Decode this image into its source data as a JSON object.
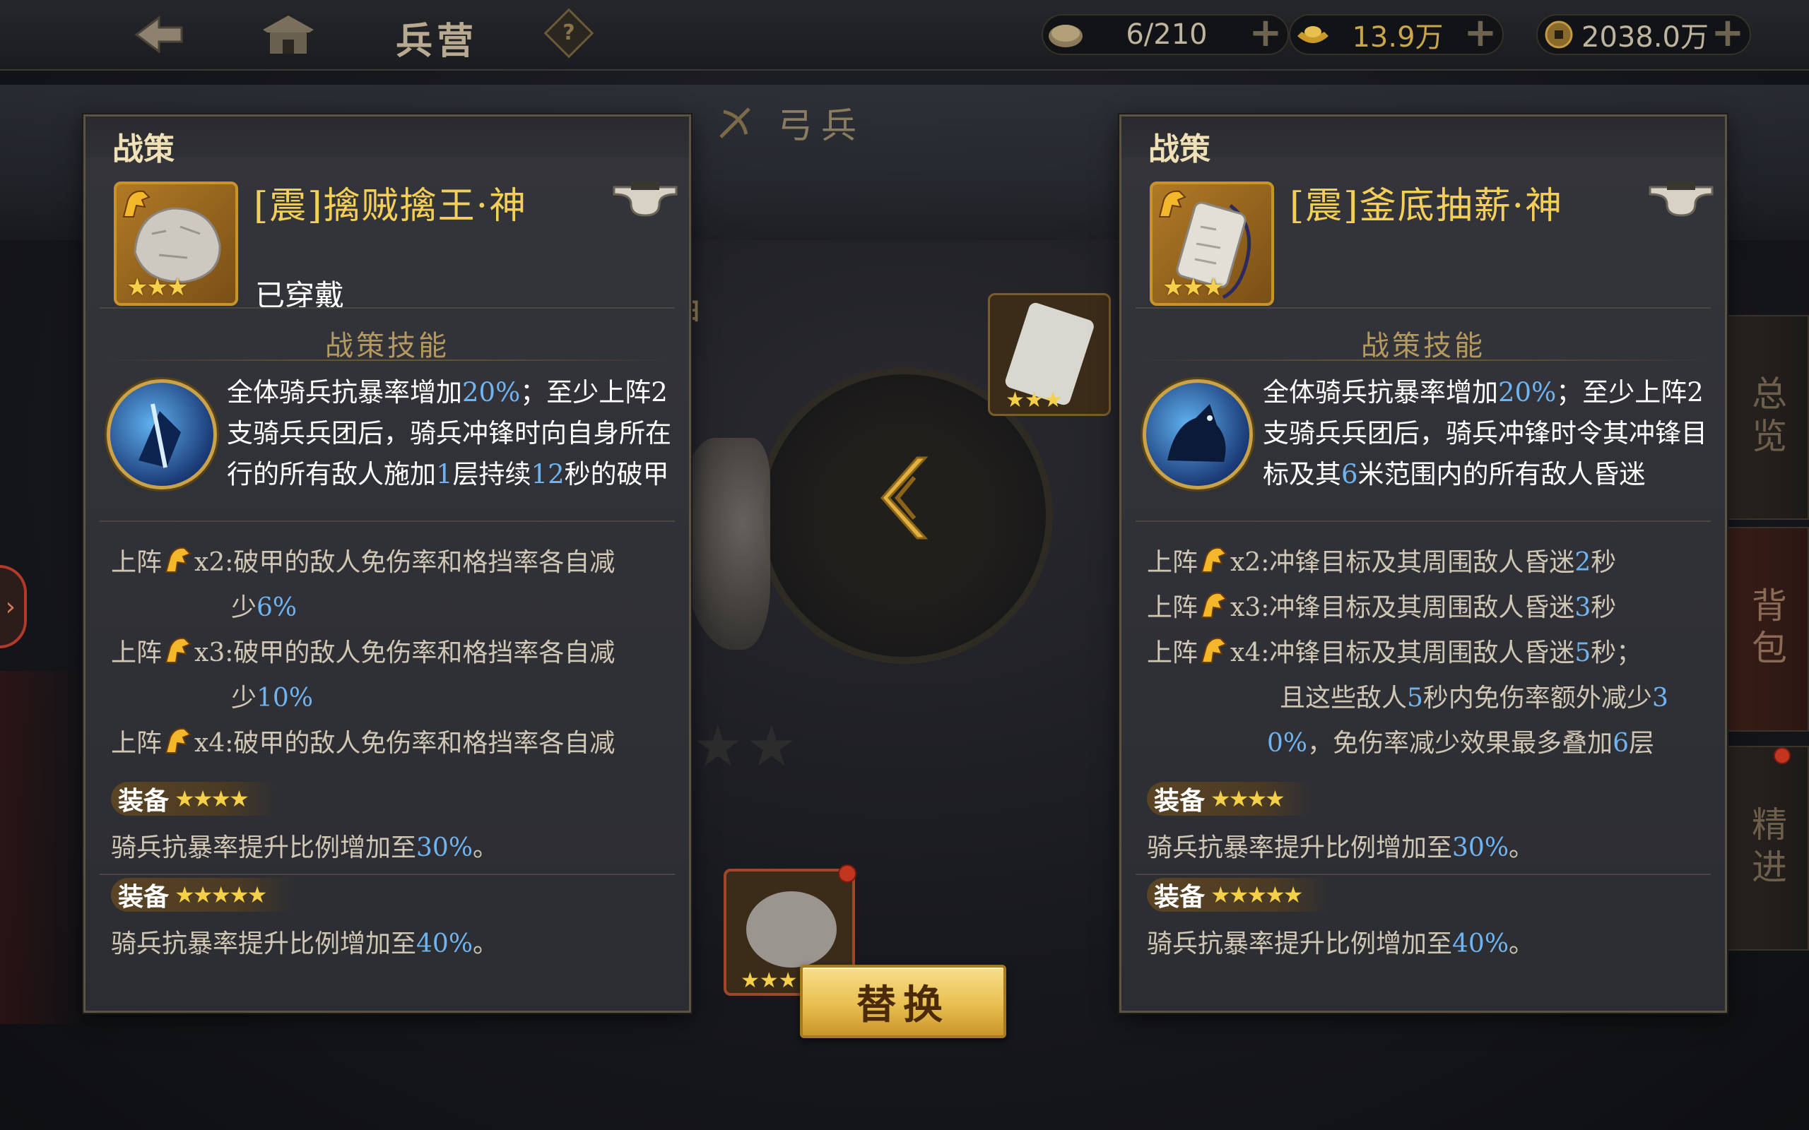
{
  "topbar": {
    "title": "兵营",
    "help": "?",
    "resources": [
      {
        "icon": "food-icon",
        "value": "6/210"
      },
      {
        "icon": "gold-ingot-icon",
        "value": "13.9万"
      },
      {
        "icon": "coin-icon",
        "value": "2038.0万"
      }
    ]
  },
  "tabs": {
    "archer": "弓兵"
  },
  "center": {
    "title_fragment": "· 神"
  },
  "right_nav": [
    "总览",
    "背包",
    "精进"
  ],
  "replace_button": "替换",
  "left_panel": {
    "label": "战策",
    "name": "[震]擒贼擒王·神",
    "status": "已穿戴",
    "stars": 3,
    "section_title": "战策技能",
    "skill_parts": [
      {
        "t": "全体骑兵抗暴率增加",
        "h": false
      },
      {
        "t": "20%",
        "h": true
      },
      {
        "t": "；至少上阵2支骑兵兵团后，骑兵冲锋时向自身所在行的所有敌人施加",
        "h": false
      },
      {
        "t": "1",
        "h": true
      },
      {
        "t": "层持续",
        "h": false
      },
      {
        "t": "12",
        "h": true
      },
      {
        "t": "秒的破甲",
        "h": false
      }
    ],
    "tiers": [
      {
        "prefix": "上阵",
        "count": "x2:",
        "text": "破甲的敌人免伤率和格挡率各自减",
        "cont": "少",
        "val": "6%"
      },
      {
        "prefix": "上阵",
        "count": "x3:",
        "text": "破甲的敌人免伤率和格挡率各自减",
        "cont": "少",
        "val": "10%"
      },
      {
        "prefix": "上阵",
        "count": "x4:",
        "text": "破甲的敌人免伤率和格挡率各自减",
        "cont": "",
        "val": ""
      }
    ],
    "equips": [
      {
        "label": "装备",
        "stars": "★★★★",
        "desc_a": "骑兵抗暴率提升比例增加至",
        "val": "30%",
        "desc_b": "。"
      },
      {
        "label": "装备",
        "stars": "★★★★★",
        "desc_a": "骑兵抗暴率提升比例增加至",
        "val": "40%",
        "desc_b": "。"
      }
    ]
  },
  "right_panel": {
    "label": "战策",
    "name": "[震]釜底抽薪·神",
    "stars": 3,
    "section_title": "战策技能",
    "skill_parts": [
      {
        "t": "全体骑兵抗暴率增加",
        "h": false
      },
      {
        "t": "20%",
        "h": true
      },
      {
        "t": "；至少上阵2支骑兵兵团后，骑兵冲锋时令其冲锋目标及其",
        "h": false
      },
      {
        "t": "6",
        "h": true
      },
      {
        "t": "米范围内的所有敌人昏迷",
        "h": false
      }
    ],
    "tiers": [
      {
        "prefix": "上阵",
        "count": "x2:",
        "text": "冲锋目标及其周围敌人昏迷",
        "val": "2",
        "unit": "秒"
      },
      {
        "prefix": "上阵",
        "count": "x3:",
        "text": "冲锋目标及其周围敌人昏迷",
        "val": "3",
        "unit": "秒"
      },
      {
        "prefix": "上阵",
        "count": "x4:",
        "text": "冲锋目标及其周围敌人昏迷",
        "val": "5",
        "unit": "秒；"
      }
    ],
    "tier4_extra": [
      {
        "t": "且这些敌人",
        "h": false
      },
      {
        "t": "5",
        "h": true
      },
      {
        "t": "秒内免伤率额外减少",
        "h": false
      },
      {
        "t": "3",
        "h": true
      }
    ],
    "tier4_extra2": [
      {
        "t": "0%",
        "h": true
      },
      {
        "t": "，免伤率减少效果最多叠加",
        "h": false
      },
      {
        "t": "6",
        "h": true
      },
      {
        "t": "层",
        "h": false
      }
    ],
    "equips": [
      {
        "label": "装备",
        "stars": "★★★★",
        "desc_a": "骑兵抗暴率提升比例增加至",
        "val": "30%",
        "desc_b": "。"
      },
      {
        "label": "装备",
        "stars": "★★★★★",
        "desc_a": "骑兵抗暴率提升比例增加至",
        "val": "40%",
        "desc_b": "。"
      }
    ]
  }
}
